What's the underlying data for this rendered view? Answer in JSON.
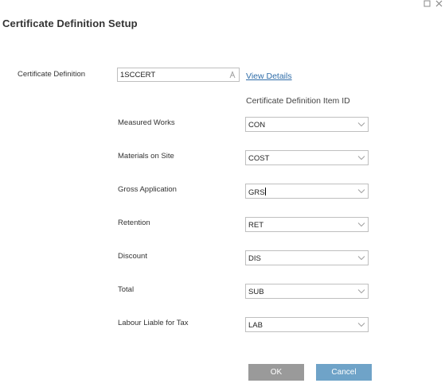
{
  "window": {
    "title": "Certificate Definition Setup",
    "controls": [
      "maximize-icon",
      "close-icon"
    ]
  },
  "certificate_definition": {
    "label": "Certificate Definition",
    "value": "1SCCERT",
    "view_details_label": "View Details"
  },
  "item_column_header": "Certificate Definition Item ID",
  "rows": [
    {
      "label": "Measured Works",
      "value": "CON"
    },
    {
      "label": "Materials on Site",
      "value": "COST"
    },
    {
      "label": "Gross Application",
      "value": "GRS"
    },
    {
      "label": "Retention",
      "value": "RET"
    },
    {
      "label": "Discount",
      "value": "DIS"
    },
    {
      "label": "Total",
      "value": "SUB"
    },
    {
      "label": "Labour Liable for Tax",
      "value": "LAB"
    }
  ],
  "buttons": {
    "ok_label": "OK",
    "cancel_label": "Cancel"
  },
  "colors": {
    "link": "#2e6ca8",
    "ok_button": "#9a9a9a",
    "cancel_button": "#6fa3c8",
    "border": "#bfbfbf"
  }
}
